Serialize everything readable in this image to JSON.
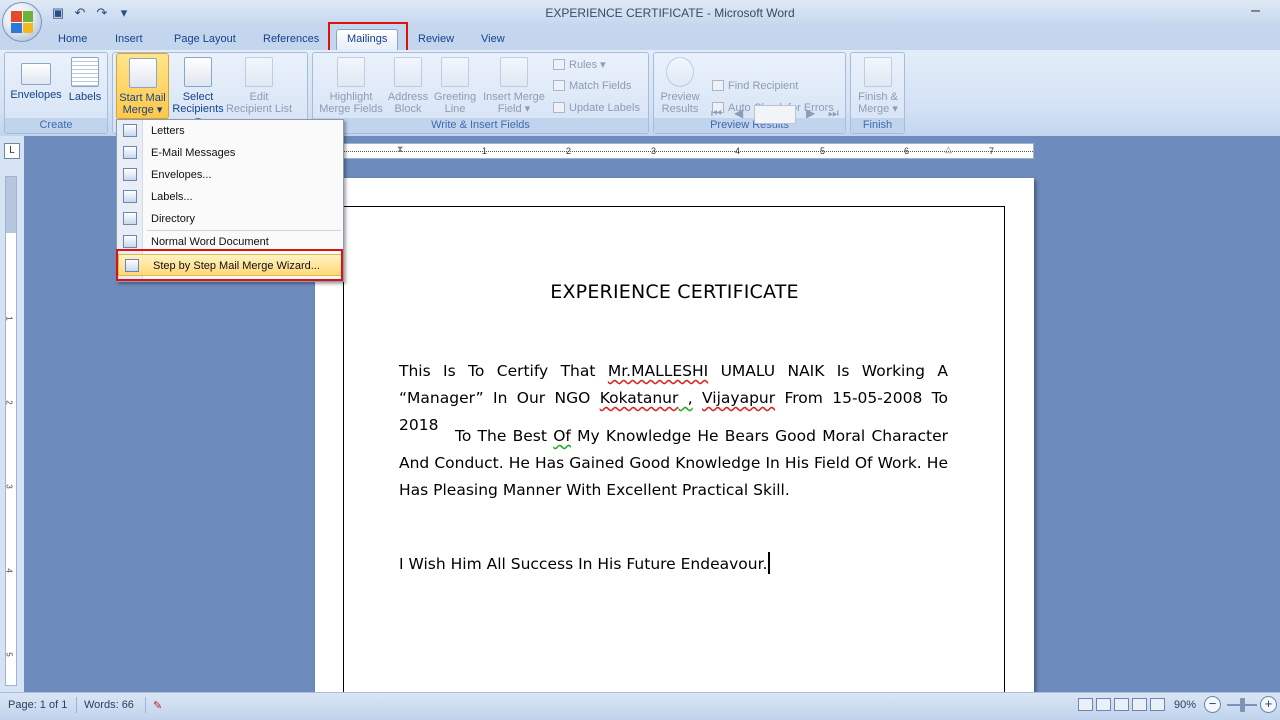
{
  "window": {
    "title": "EXPERIENCE CERTIFICATE - Microsoft Word",
    "minimize": "–"
  },
  "quick_access": {
    "icons": [
      "save-icon",
      "undo-icon",
      "redo-icon",
      "customize-icon"
    ]
  },
  "tabs": [
    {
      "label": "Home"
    },
    {
      "label": "Insert"
    },
    {
      "label": "Page Layout"
    },
    {
      "label": "References"
    },
    {
      "label": "Mailings",
      "active": true
    },
    {
      "label": "Review"
    },
    {
      "label": "View"
    }
  ],
  "ribbon": {
    "create": {
      "label": "Create",
      "envelopes": "Envelopes",
      "labels": "Labels"
    },
    "start": {
      "start_mail_1": "Start Mail",
      "start_mail_2": "Merge ▾",
      "select_1": "Select",
      "select_2": "Recipients ▾",
      "edit_1": "Edit",
      "edit_2": "Recipient List"
    },
    "write": {
      "label": "Write & Insert Fields",
      "highlight_1": "Highlight",
      "highlight_2": "Merge Fields",
      "address_1": "Address",
      "address_2": "Block",
      "greeting_1": "Greeting",
      "greeting_2": "Line",
      "insert_1": "Insert Merge",
      "insert_2": "Field ▾",
      "rules": "Rules ▾",
      "match": "Match Fields",
      "update": "Update Labels"
    },
    "preview": {
      "label": "Preview Results",
      "preview_1": "Preview",
      "preview_2": "Results",
      "find": "Find Recipient",
      "auto": "Auto Check for Errors"
    },
    "finish": {
      "label": "Finish",
      "finish_1": "Finish &",
      "finish_2": "Merge ▾"
    }
  },
  "menu": {
    "items": [
      {
        "label": "Letters"
      },
      {
        "label": "E-Mail Messages"
      },
      {
        "label": "Envelopes..."
      },
      {
        "label": "Labels..."
      },
      {
        "label": "Directory"
      },
      {
        "label": "Normal Word Document"
      },
      {
        "label": "Step by Step Mail Merge Wizard...",
        "selected": true
      }
    ]
  },
  "ruler": {
    "h_numbers": [
      "1",
      "2",
      "3",
      "4",
      "5",
      "6",
      "7"
    ],
    "v_numbers": [
      "1",
      "2",
      "3",
      "4",
      "5"
    ],
    "tab_stop": "L"
  },
  "document": {
    "title": "EXPERIENCE CERTIFICATE",
    "p1_a": "This Is To Certify That ",
    "p1_name": "Mr.MALLESHI",
    "p1_b": " UMALU NAIK Is Working A “Manager” In Our NGO ",
    "p1_place1": "Kokatanur",
    "p1_comma": " ,",
    "p1_c": " ",
    "p1_place2": "Vijayapur",
    "p1_d": " From 15-05-2008 To 2018",
    "p2_a": "To The Best ",
    "p2_of": "Of",
    "p2_b": " My Knowledge He Bears Good Moral Character And Conduct. He Has Gained Good Knowledge In His Field Of Work. He Has Pleasing Manner With Excellent  Practical Skill.",
    "p3": "I Wish Him All Success In His Future Endeavour."
  },
  "status": {
    "page": "Page: 1 of 1",
    "words": "Words: 66",
    "zoom": "90%",
    "zoom_minus": "−",
    "zoom_plus": "+"
  }
}
